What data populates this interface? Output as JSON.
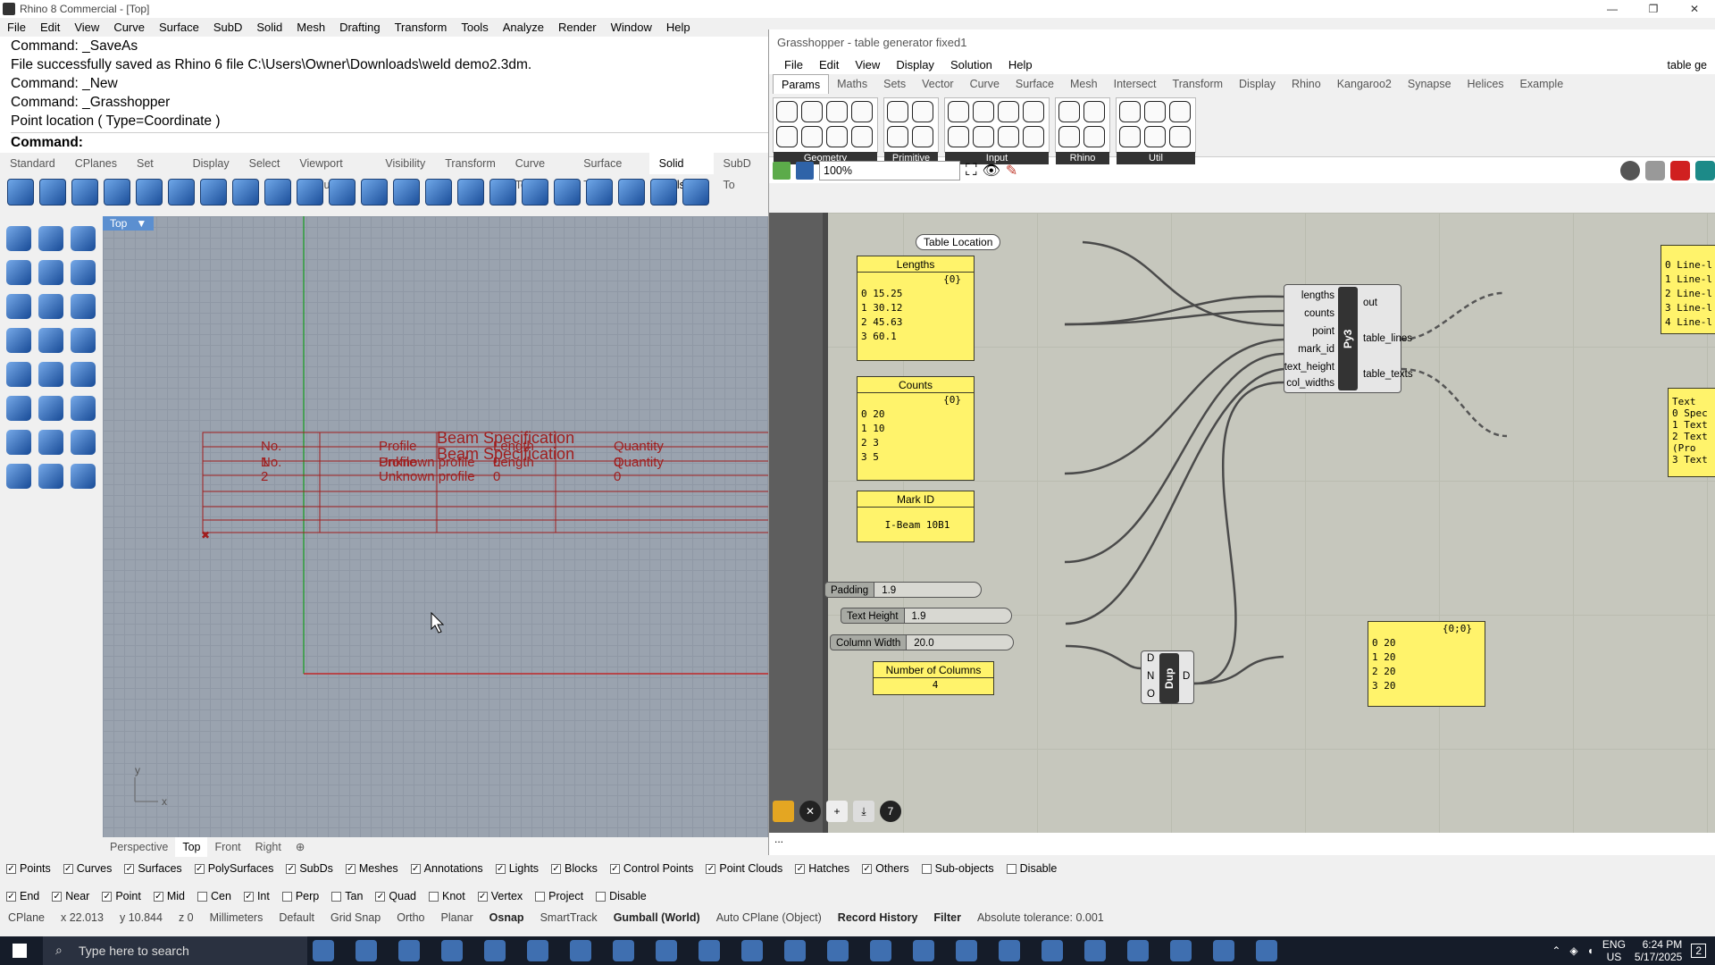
{
  "rhino": {
    "title": "Rhino 8 Commercial - [Top]",
    "menu": [
      "File",
      "Edit",
      "View",
      "Curve",
      "Surface",
      "SubD",
      "Solid",
      "Mesh",
      "Drafting",
      "Transform",
      "Tools",
      "Analyze",
      "Render",
      "Window",
      "Help"
    ],
    "command_history": [
      "Command: _SaveAs",
      "File successfully saved as Rhino 6 file C:\\Users\\Owner\\Downloads\\weld demo2.3dm.",
      "Command: _New",
      "Command: _Grasshopper",
      "Point location ( Type=Coordinate )"
    ],
    "command_prompt": "Command:",
    "toolbar_tabs": [
      "Standard",
      "CPlanes",
      "Set View",
      "Display",
      "Select",
      "Viewport Layout",
      "Visibility",
      "Transform",
      "Curve Tools",
      "Surface Tools",
      "Solid Tools",
      "SubD To"
    ],
    "active_toolbar_tab": "Solid Tools",
    "viewport": {
      "label": "Top",
      "menu_arrow": "▼",
      "axis_x": "x",
      "axis_y": "y",
      "table_texts": [
        "No.",
        "Profile",
        "Beam Specification",
        "Length",
        "Quantity",
        "No.",
        "Profile",
        "Beam Specification",
        "Length",
        "Quantity",
        "1",
        "Unknown profile",
        "0",
        "2",
        "Unknown profile",
        "0",
        "0",
        "0"
      ],
      "tabs": [
        "Perspective",
        "Top",
        "Front",
        "Right"
      ],
      "active_tab": "Top"
    },
    "filters": [
      {
        "label": "Points",
        "checked": true
      },
      {
        "label": "Curves",
        "checked": true
      },
      {
        "label": "Surfaces",
        "checked": true
      },
      {
        "label": "PolySurfaces",
        "checked": true
      },
      {
        "label": "SubDs",
        "checked": true
      },
      {
        "label": "Meshes",
        "checked": true
      },
      {
        "label": "Annotations",
        "checked": true
      },
      {
        "label": "Lights",
        "checked": true
      },
      {
        "label": "Blocks",
        "checked": true
      },
      {
        "label": "Control Points",
        "checked": true
      },
      {
        "label": "Point Clouds",
        "checked": true
      },
      {
        "label": "Hatches",
        "checked": true
      },
      {
        "label": "Others",
        "checked": true
      },
      {
        "label": "Sub-objects",
        "checked": false
      },
      {
        "label": "Disable",
        "checked": false
      }
    ],
    "osnaps": [
      {
        "label": "End",
        "checked": true
      },
      {
        "label": "Near",
        "checked": true
      },
      {
        "label": "Point",
        "checked": true
      },
      {
        "label": "Mid",
        "checked": true
      },
      {
        "label": "Cen",
        "checked": false
      },
      {
        "label": "Int",
        "checked": true
      },
      {
        "label": "Perp",
        "checked": false
      },
      {
        "label": "Tan",
        "checked": false
      },
      {
        "label": "Quad",
        "checked": true
      },
      {
        "label": "Knot",
        "checked": false
      },
      {
        "label": "Vertex",
        "checked": true
      },
      {
        "label": "Project",
        "checked": false
      },
      {
        "label": "Disable",
        "checked": false
      }
    ],
    "status": {
      "cplane": "CPlane",
      "x": "x 22.013",
      "y": "y 10.844",
      "z": "z 0",
      "units": "Millimeters",
      "layer": "Default",
      "toggles": [
        "Grid Snap",
        "Ortho",
        "Planar",
        "Osnap",
        "SmartTrack",
        "Gumball (World)",
        "Auto CPlane (Object)",
        "Record History",
        "Filter"
      ],
      "tolerance": "Absolute tolerance: 0.001"
    }
  },
  "grasshopper": {
    "title": "Grasshopper - table generator fixed1",
    "menu": [
      "File",
      "Edit",
      "View",
      "Display",
      "Solution",
      "Help"
    ],
    "doc_name": "table ge",
    "tabs": [
      "Params",
      "Maths",
      "Sets",
      "Vector",
      "Curve",
      "Surface",
      "Mesh",
      "Intersect",
      "Transform",
      "Display",
      "Rhino",
      "Kangaroo2",
      "Synapse",
      "Helices",
      "Example"
    ],
    "active_tab": "Params",
    "groups": [
      {
        "label": "Geometry",
        "icons": 8
      },
      {
        "label": "Primitive",
        "icons": 4
      },
      {
        "label": "Input",
        "icons": 8
      },
      {
        "label": "Rhino",
        "icons": 4
      },
      {
        "label": "Util",
        "icons": 6
      }
    ],
    "zoom": "100%",
    "canvas": {
      "table_location": "Table Location",
      "lengths": {
        "title": "Lengths",
        "path": "{0}",
        "items": [
          "0 15.25",
          "1 30.12",
          "2 45.63",
          "3 60.1"
        ]
      },
      "counts": {
        "title": "Counts",
        "path": "{0}",
        "items": [
          "0 20",
          "1 10",
          "2 3",
          "3 5"
        ]
      },
      "mark_id": {
        "title": "Mark ID",
        "value": "I-Beam 10B1"
      },
      "sliders": [
        {
          "name": "Padding",
          "value": "1.9"
        },
        {
          "name": "Text Height",
          "value": "1.9"
        },
        {
          "name": "Column Width",
          "value": "20.0"
        }
      ],
      "num_columns": {
        "title": "Number of Columns",
        "value": "4"
      },
      "py3": {
        "label": "Py3",
        "inputs": [
          "lengths",
          "counts",
          "point",
          "mark_id",
          "text_height",
          "col_widths"
        ],
        "outputs": [
          "out",
          "table_lines",
          "table_texts"
        ]
      },
      "dup": {
        "label": "Dup",
        "inputs": [
          "D",
          "N",
          "O"
        ],
        "output": "D"
      },
      "dup_panel": {
        "path": "{0;0}",
        "items": [
          "0 20",
          "1 20",
          "2 20",
          "3 20"
        ]
      },
      "lines_panel": {
        "items": [
          "0 Line-l",
          "1 Line-l",
          "2 Line-l",
          "3 Line-l",
          "4 Line-l"
        ]
      },
      "texts_panel": {
        "items": [
          "Text",
          "0 Spec",
          "1 Text",
          "2 Text",
          "(Pro",
          "3 Text"
        ]
      }
    },
    "bottom_text": "..."
  },
  "taskbar": {
    "search_placeholder": "Type here to search",
    "lang": "ENG",
    "region": "US",
    "time": "6:24 PM",
    "date": "5/17/2025",
    "notifications": "2"
  }
}
